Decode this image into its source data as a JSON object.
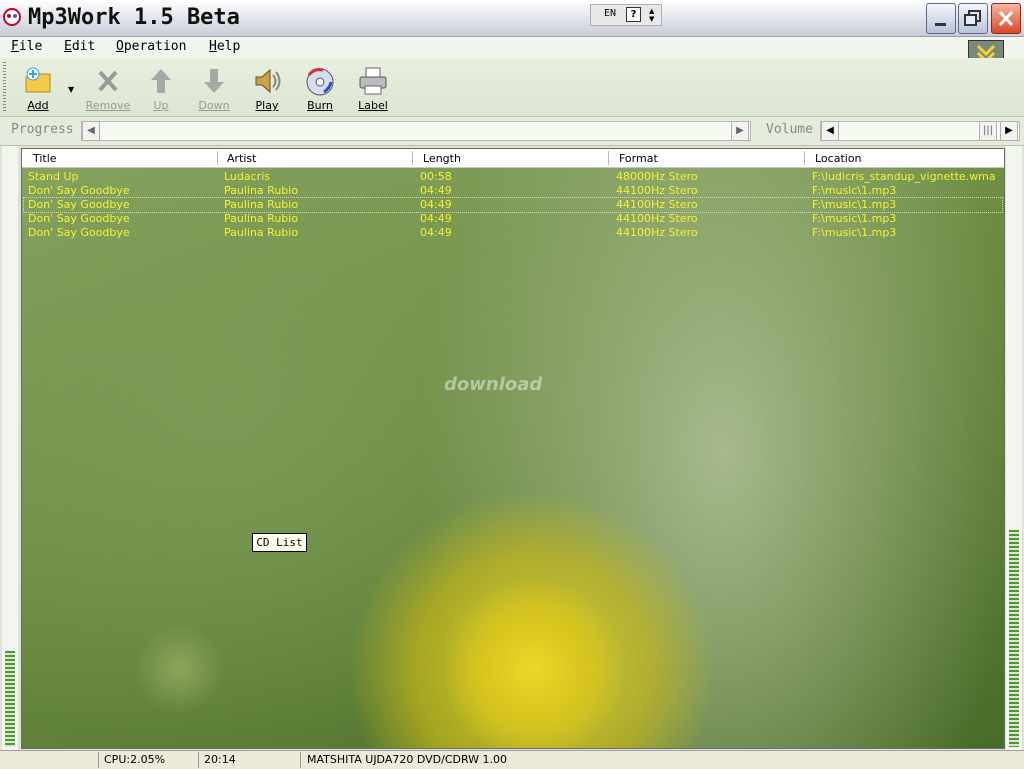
{
  "window": {
    "title": "Mp3Work 1.5 Beta"
  },
  "language_bar": {
    "code": "EN",
    "help": "?"
  },
  "menu": [
    {
      "label": "File"
    },
    {
      "label": "Edit"
    },
    {
      "label": "Operation"
    },
    {
      "label": "Help"
    }
  ],
  "toolbar": {
    "add": "Add",
    "remove": "Remove",
    "up": "Up",
    "down": "Down",
    "play": "Play",
    "burn": "Burn",
    "label": "Label"
  },
  "progress": {
    "label": "Progress"
  },
  "volume": {
    "label": "Volume"
  },
  "columns": [
    "Title",
    "Artist",
    "Length",
    "Format",
    "Location"
  ],
  "tracks": [
    {
      "title": "Stand Up",
      "artist": "Ludacris",
      "length": "00:58",
      "format": "48000Hz Stero",
      "location": "F:\\ludicris_standup_vignette.wma"
    },
    {
      "title": "Don' Say Goodbye",
      "artist": "Paulina Rubio",
      "length": "04:49",
      "format": "44100Hz Stero",
      "location": "F:\\music\\1.mp3"
    },
    {
      "title": "Don' Say Goodbye",
      "artist": "Paulina Rubio",
      "length": "04:49",
      "format": "44100Hz Stero",
      "location": "F:\\music\\1.mp3"
    },
    {
      "title": "Don' Say Goodbye",
      "artist": "Paulina Rubio",
      "length": "04:49",
      "format": "44100Hz Stero",
      "location": "F:\\music\\1.mp3"
    },
    {
      "title": "Don' Say Goodbye",
      "artist": "Paulina Rubio",
      "length": "04:49",
      "format": "44100Hz Stero",
      "location": "F:\\music\\1.mp3"
    }
  ],
  "selected_row": 2,
  "tooltip": "CD List",
  "watermark": "download",
  "status": {
    "cpu": "CPU:2.05%",
    "time": "20:14",
    "drive": "MATSHITA UJDA720 DVD/CDRW 1.00"
  },
  "colors": {
    "track_text": "#f6f03a",
    "vu_meter": "#4f9a2e"
  }
}
